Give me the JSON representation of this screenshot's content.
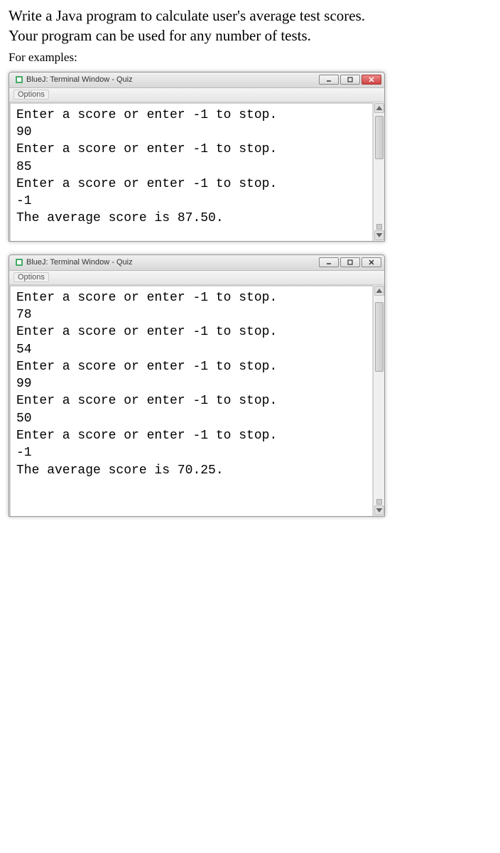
{
  "instruction": {
    "line1": "Write a Java program to calculate user's average test scores.",
    "line2": "Your program can be used for any number of tests."
  },
  "example_label": "For examples:",
  "window_title": "BlueJ: Terminal Window - Quiz",
  "menu": {
    "options": "Options"
  },
  "terminal1": {
    "lines": "Enter a score or enter -1 to stop.\n90\nEnter a score or enter -1 to stop.\n85\nEnter a score or enter -1 to stop.\n-1\nThe average score is 87.50."
  },
  "terminal2": {
    "lines": "Enter a score or enter -1 to stop.\n78\nEnter a score or enter -1 to stop.\n54\nEnter a score or enter -1 to stop.\n99\nEnter a score or enter -1 to stop.\n50\nEnter a score or enter -1 to stop.\n-1\nThe average score is 70.25."
  }
}
